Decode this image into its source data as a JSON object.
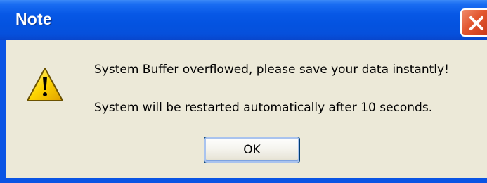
{
  "dialog": {
    "title": "Note",
    "icon": "warning-icon",
    "messages": [
      "System Buffer overflowed, please save your data instantly!",
      "System will be restarted automatically after 10 seconds."
    ],
    "ok_label": "OK",
    "close_icon": "close-icon"
  },
  "colors": {
    "titlebar": "#0453e0",
    "client_background": "#ece9d8",
    "close_button": "#e2552e",
    "warning_icon": "#fdd400"
  }
}
